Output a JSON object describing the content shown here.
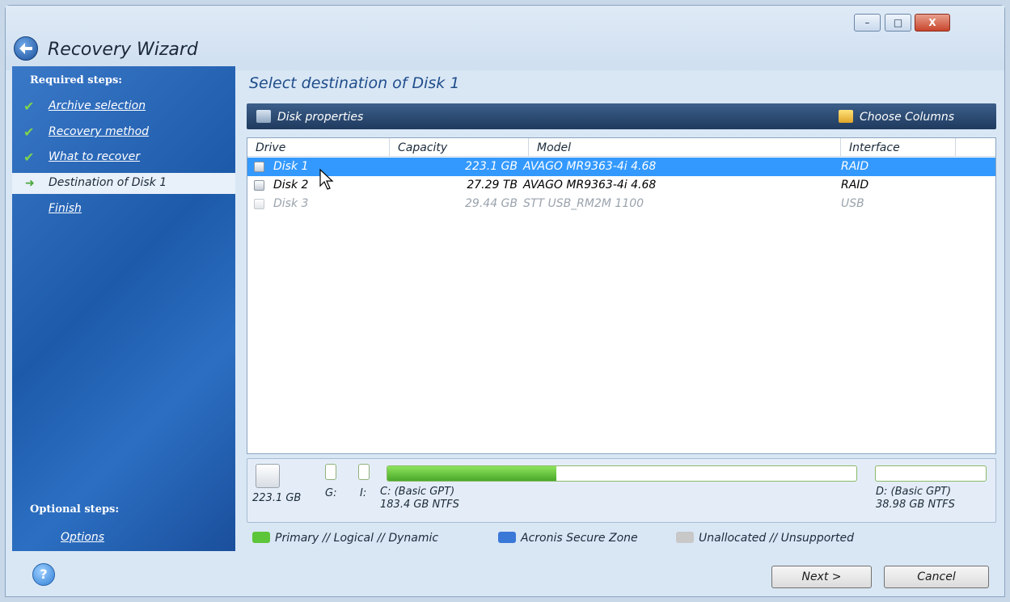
{
  "window": {
    "title": "Recovery Wizard",
    "controls": {
      "minimize": "–",
      "maximize": "□",
      "close": "X"
    }
  },
  "sidebar": {
    "required_heading": "Required steps:",
    "steps": [
      {
        "label": "Archive selection",
        "state": "done"
      },
      {
        "label": "Recovery method",
        "state": "done"
      },
      {
        "label": "What to recover",
        "state": "done"
      },
      {
        "label": "Destination of Disk 1",
        "state": "active"
      },
      {
        "label": "Finish",
        "state": "pending"
      }
    ],
    "optional_heading": "Optional steps:",
    "optional_steps": [
      {
        "label": "Options"
      }
    ],
    "check_glyph": "✔",
    "arrow_glyph": "➜"
  },
  "main": {
    "title": "Select destination of Disk 1",
    "toolbar": {
      "disk_properties": "Disk properties",
      "choose_columns": "Choose Columns"
    },
    "table": {
      "columns": [
        "Drive",
        "Capacity",
        "Model",
        "Interface"
      ],
      "rows": [
        {
          "drive": "Disk 1",
          "capacity": "223.1 GB",
          "model": "AVAGO MR9363-4i 4.68",
          "interface": "RAID",
          "selected": true,
          "disabled": false
        },
        {
          "drive": "Disk 2",
          "capacity": "27.29 TB",
          "model": "AVAGO MR9363-4i 4.68",
          "interface": "RAID",
          "selected": false,
          "disabled": false
        },
        {
          "drive": "Disk 3",
          "capacity": "29.44 GB",
          "model": "STT USB_RM2M 1100",
          "interface": "USB",
          "selected": false,
          "disabled": true
        }
      ]
    },
    "disk_map": {
      "disk_size": "223.1 GB",
      "small_partitions": [
        {
          "label": "G:"
        },
        {
          "label": "I:"
        }
      ],
      "partition_c": {
        "name": "C: (Basic GPT)",
        "size": "183.4 GB  NTFS",
        "used_fraction": 0.36
      },
      "partition_d": {
        "name": "D: (Basic GPT)",
        "size": "38.98 GB  NTFS",
        "used_fraction": 0.0
      }
    },
    "legend": [
      {
        "label": "Primary // Logical // Dynamic",
        "color": "#5cc53a"
      },
      {
        "label": "Acronis Secure Zone",
        "color": "#3a78d8"
      },
      {
        "label": "Unallocated // Unsupported",
        "color": "#c8c8c8"
      }
    ]
  },
  "buttons": {
    "help": "?",
    "next": "Next >",
    "cancel": "Cancel"
  },
  "colors": {
    "accent": "#3399ff",
    "sidebar": "#1d5aaa",
    "toolbar": "#2a4a72"
  }
}
